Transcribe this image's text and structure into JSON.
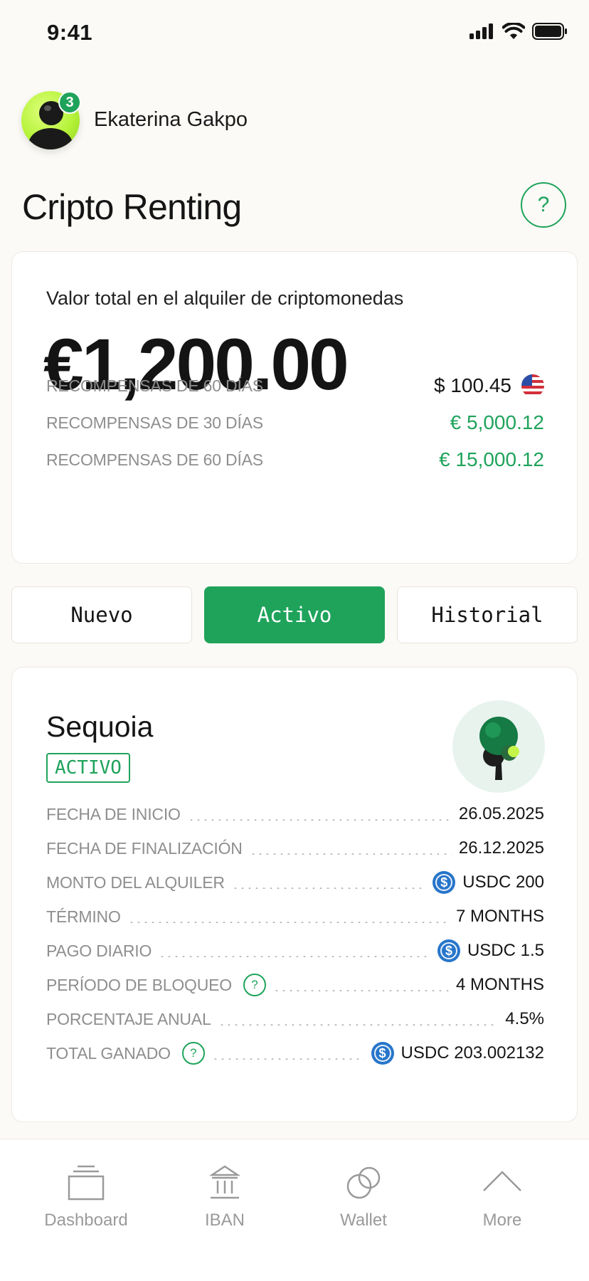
{
  "status_bar": {
    "time": "9:41"
  },
  "user": {
    "name": "Ekaterina Gakpo",
    "notification_count": "3"
  },
  "page": {
    "title": "Cripto Renting",
    "help_label": "?"
  },
  "summary": {
    "label": "Valor total en el alquiler de criptomonedas",
    "total": "€1,200.00",
    "rewards": [
      {
        "label": "RECOMPENSAS DE 60 DÍAS",
        "value": "$ 100.45",
        "color": "#151515",
        "icon": "us-flag-icon"
      },
      {
        "label": "RECOMPENSAS DE 30 DÍAS",
        "value": "€ 5,000.12",
        "color": "#1FA35B"
      },
      {
        "label": "RECOMPENSAS DE 60 DÍAS",
        "value": "€ 15,000.12",
        "color": "#1FA35B"
      }
    ]
  },
  "tabs": [
    {
      "label": "Nuevo",
      "active": false
    },
    {
      "label": "Activo",
      "active": true
    },
    {
      "label": "Historial",
      "active": false
    }
  ],
  "rental": {
    "name": "Sequoia",
    "status": "ACTIVO",
    "icon": "tree-icon",
    "rows": [
      {
        "label": "FECHA DE INICIO",
        "value": "26.05.2025"
      },
      {
        "label": "FECHA DE FINALIZACIÓN",
        "value": "26.12.2025"
      },
      {
        "label": "MONTO DEL ALQUILER",
        "value": "USDC 200",
        "icon": "usdc-icon"
      },
      {
        "label": "TÉRMINO",
        "value": "7 MONTHS"
      },
      {
        "label": "PAGO DIARIO",
        "value": "USDC 1.5",
        "icon": "usdc-icon"
      },
      {
        "label": "PERÍODO DE BLOQUEO",
        "value": "4 MONTHS",
        "help": "?"
      },
      {
        "label": "PORCENTAJE ANUAL",
        "value": "4.5%"
      },
      {
        "label": "TOTAL GANADO",
        "value": "USDC 203.002132",
        "icon": "usdc-icon",
        "help": "?"
      }
    ]
  },
  "nav": {
    "items": [
      {
        "label": "Dashboard",
        "icon": "dashboard-icon"
      },
      {
        "label": "IBAN",
        "icon": "bank-icon"
      },
      {
        "label": "Wallet",
        "icon": "wallet-icon"
      },
      {
        "label": "More",
        "icon": "chevron-up-icon"
      }
    ]
  },
  "colors": {
    "accent": "#1FA35B",
    "background": "#FBFAF6",
    "muted": "#8E8E8E"
  }
}
